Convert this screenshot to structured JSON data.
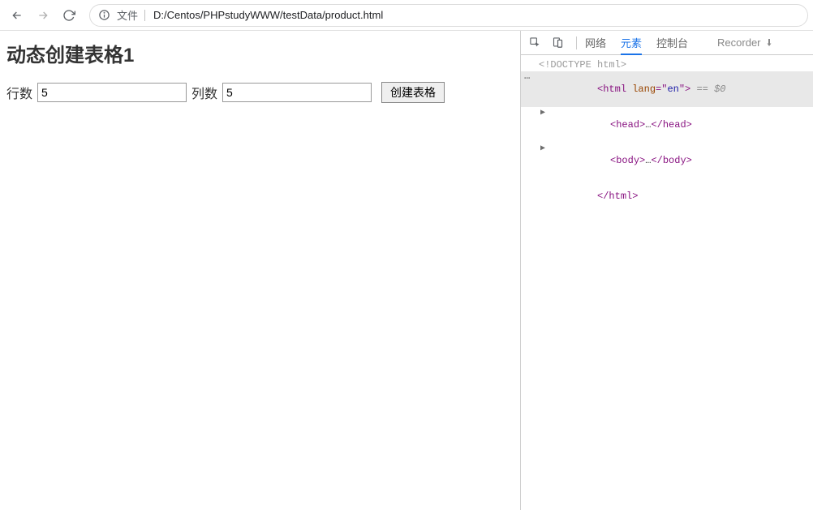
{
  "toolbar": {
    "file_label": "文件",
    "url": "D:/Centos/PHPstudyWWW/testData/product.html"
  },
  "page": {
    "heading": "动态创建表格1",
    "row_label": "行数",
    "row_value": "5",
    "col_label": "列数",
    "col_value": "5",
    "button_label": "创建表格"
  },
  "devtools": {
    "tabs": {
      "network": "网络",
      "elements": "元素",
      "console": "控制台",
      "recorder": "Recorder"
    },
    "dom": {
      "doctype": "<!DOCTYPE html>",
      "html_open_1": "<",
      "html_open_2": "html",
      "html_open_3": " ",
      "html_open_4": "lang",
      "html_open_5": "=\"",
      "html_open_6": "en",
      "html_open_7": "\">",
      "eq_sel": " == $0",
      "head_open": "<head>",
      "ellipsis": "…",
      "head_close": "</head>",
      "body_open": "<body>",
      "body_close": "</body>",
      "html_close": "</html>"
    }
  }
}
